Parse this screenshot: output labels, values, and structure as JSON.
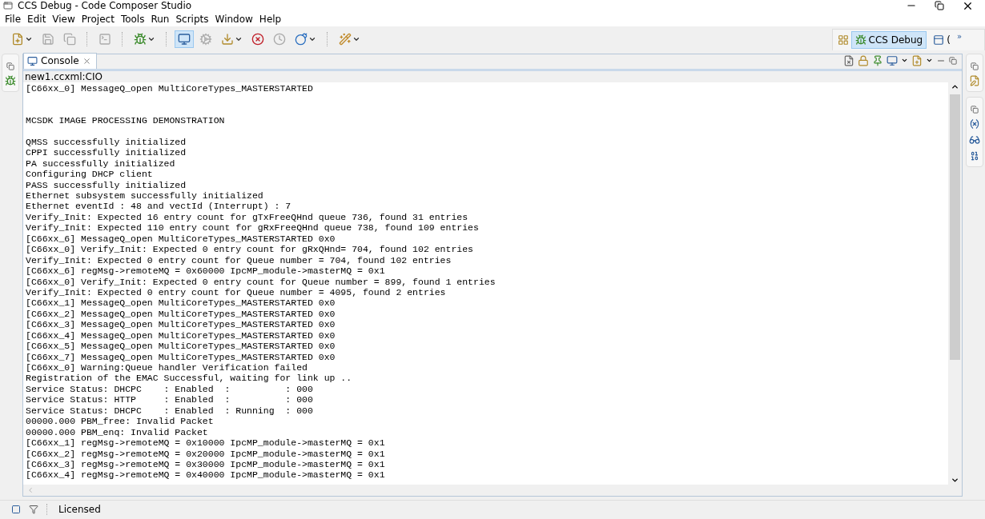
{
  "window": {
    "title": "CCS Debug - Code Composer Studio"
  },
  "menu": [
    "File",
    "Edit",
    "View",
    "Project",
    "Tools",
    "Run",
    "Scripts",
    "Window",
    "Help"
  ],
  "toolbar": [
    {
      "kind": "new",
      "dropdown": true,
      "disabled": false,
      "selected": false
    },
    {
      "kind": "save",
      "dropdown": false,
      "disabled": true,
      "selected": false
    },
    {
      "kind": "save-all",
      "dropdown": false,
      "disabled": true,
      "selected": false
    },
    {
      "kind": "separator"
    },
    {
      "kind": "terminal",
      "dropdown": false,
      "disabled": true,
      "selected": false
    },
    {
      "kind": "separator"
    },
    {
      "kind": "debug",
      "dropdown": true,
      "disabled": false,
      "selected": false
    },
    {
      "kind": "separator"
    },
    {
      "kind": "connect",
      "dropdown": false,
      "disabled": false,
      "selected": true
    },
    {
      "kind": "settings",
      "dropdown": false,
      "disabled": true,
      "selected": false
    },
    {
      "kind": "load",
      "dropdown": true,
      "disabled": false,
      "selected": false
    },
    {
      "kind": "breakpoint",
      "dropdown": false,
      "disabled": false,
      "selected": false
    },
    {
      "kind": "clock",
      "dropdown": false,
      "disabled": true,
      "selected": false
    },
    {
      "kind": "bomb",
      "dropdown": true,
      "disabled": false,
      "selected": false
    },
    {
      "kind": "separator"
    },
    {
      "kind": "wand",
      "dropdown": true,
      "disabled": false,
      "selected": false
    }
  ],
  "perspectives": [
    {
      "label": "CCS Debug",
      "selected": true
    },
    {
      "label": "(",
      "selected": false
    }
  ],
  "perspective_overflow": "»",
  "console": {
    "tab": "Console",
    "source": "new1.ccxml:CIO",
    "lines": [
      {
        "kind": "text",
        "text": "[C66xx_0] MessageQ_open MultiCoreTypes_MASTERSTARTED"
      },
      {
        "kind": "blank"
      },
      {
        "kind": "blank"
      },
      {
        "kind": "text",
        "text": "MCSDK IMAGE PROCESSING DEMONSTRATION"
      },
      {
        "kind": "blank"
      },
      {
        "kind": "text",
        "text": "QMSS successfully initialized"
      },
      {
        "kind": "text",
        "text": "CPPI successfully initialized"
      },
      {
        "kind": "text",
        "text": "PA successfully initialized"
      },
      {
        "kind": "text",
        "text": "Configuring DHCP client"
      },
      {
        "kind": "text",
        "text": "PASS successfully initialized"
      },
      {
        "kind": "text",
        "text": "Ethernet subsystem successfully initialized"
      },
      {
        "kind": "text",
        "text": "Ethernet eventId : 48 and vectId (Interrupt) : 7"
      },
      {
        "kind": "text",
        "text": "Verify_Init: Expected 16 entry count for gTxFreeQHnd queue 736, found 31 entries"
      },
      {
        "kind": "text",
        "text": "Verify_Init: Expected 110 entry count for gRxFreeQHnd queue 738, found 109 entries"
      },
      {
        "kind": "text",
        "text": "[C66xx_6] MessageQ_open MultiCoreTypes_MASTERSTARTED 0x0"
      },
      {
        "kind": "text",
        "text": "[C66xx_0] Verify_Init: Expected 0 entry count for gRxQHnd= 704, found 102 entries"
      },
      {
        "kind": "text",
        "text": "Verify_Init: Expected 0 entry count for Queue number = 704, found 102 entries"
      },
      {
        "kind": "text",
        "text": "[C66xx_6] regMsg->remoteMQ = 0x60000 IpcMP_module->masterMQ = 0x1"
      },
      {
        "kind": "text",
        "text": "[C66xx_0] Verify_Init: Expected 0 entry count for Queue number = 899, found 1 entries"
      },
      {
        "kind": "text",
        "text": "Verify_Init: Expected 0 entry count for Queue number = 4095, found 2 entries"
      },
      {
        "kind": "text",
        "text": "[C66xx_1] MessageQ_open MultiCoreTypes_MASTERSTARTED 0x0"
      },
      {
        "kind": "text",
        "text": "[C66xx_2] MessageQ_open MultiCoreTypes_MASTERSTARTED 0x0"
      },
      {
        "kind": "text",
        "text": "[C66xx_3] MessageQ_open MultiCoreTypes_MASTERSTARTED 0x0"
      },
      {
        "kind": "text",
        "text": "[C66xx_4] MessageQ_open MultiCoreTypes_MASTERSTARTED 0x0"
      },
      {
        "kind": "text",
        "text": "[C66xx_5] MessageQ_open MultiCoreTypes_MASTERSTARTED 0x0"
      },
      {
        "kind": "text",
        "text": "[C66xx_7] MessageQ_open MultiCoreTypes_MASTERSTARTED 0x0"
      },
      {
        "kind": "text",
        "text": "[C66xx_0] Warning:Queue handler Verification failed"
      },
      {
        "kind": "text",
        "text": "Registration of the EMAC Successful, waiting for link up .."
      },
      {
        "kind": "text",
        "text": "Service Status: DHCPC    : Enabled  :          : 000"
      },
      {
        "kind": "text",
        "text": "Service Status: HTTP     : Enabled  :          : 000"
      },
      {
        "kind": "text",
        "text": "Service Status: DHCPC    : Enabled  : Running  : 000"
      },
      {
        "kind": "text",
        "text": "00000.000 PBM_free: Invalid Packet"
      },
      {
        "kind": "text",
        "text": "00000.000 PBM_enq: Invalid Packet"
      },
      {
        "kind": "text",
        "text": "[C66xx_1] regMsg->remoteMQ = 0x10000 IpcMP_module->masterMQ = 0x1"
      },
      {
        "kind": "text",
        "text": "[C66xx_2] regMsg->remoteMQ = 0x20000 IpcMP_module->masterMQ = 0x1"
      },
      {
        "kind": "text",
        "text": "[C66xx_3] regMsg->remoteMQ = 0x30000 IpcMP_module->masterMQ = 0x1"
      },
      {
        "kind": "text",
        "text": "[C66xx_4] regMsg->remoteMQ = 0x40000 IpcMP_module->masterMQ = 0x1"
      }
    ]
  },
  "status_bar": {
    "text": "Licensed"
  }
}
